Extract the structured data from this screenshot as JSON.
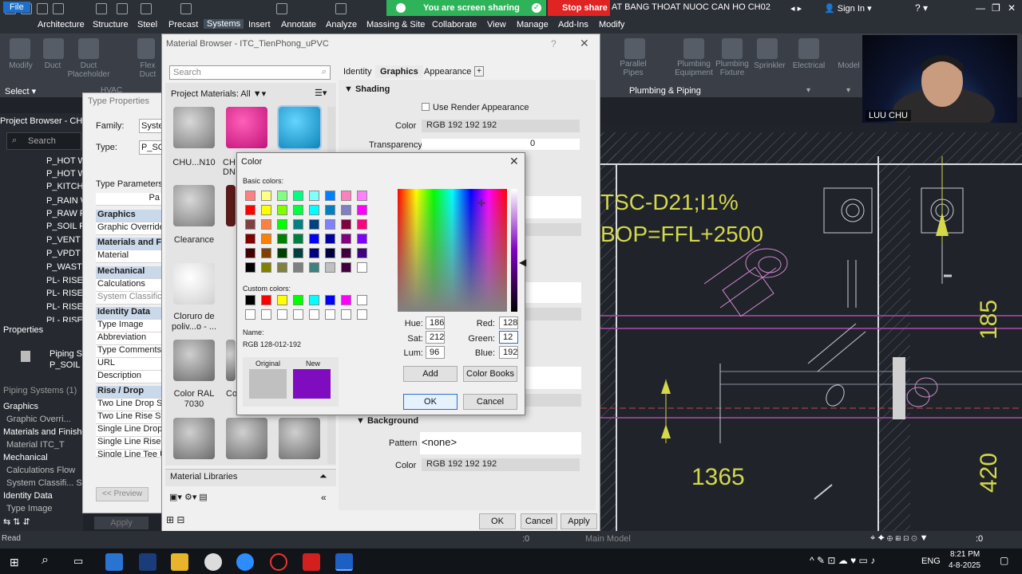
{
  "titlebar": {
    "share_text": "You are screen sharing",
    "stop_share": "Stop share",
    "doc_title": "AT BANG THOAT NUOC CAN HO CH02",
    "sign_in": "Sign In"
  },
  "menu": [
    "File",
    "Architecture",
    "Structure",
    "Steel",
    "Precast",
    "Systems",
    "Insert",
    "Annotate",
    "Analyze",
    "Massing & Site",
    "Collaborate",
    "View",
    "Manage",
    "Add-Ins",
    "Modify"
  ],
  "ribbon": {
    "tools": [
      "Modify",
      "Duct",
      "Duct Placeholder",
      "Flex Duct",
      "Parallel Pipes",
      "Plumbing Equipment",
      "Plumbing Fixture",
      "Sprinkler",
      "Electrical",
      "Model"
    ],
    "select_label": "Select",
    "hvac_label": "HVAC",
    "plumbing_panel": "Plumbing & Piping"
  },
  "project_browser": {
    "title": "Project Browser - CHU",
    "search_placeholder": "Search",
    "items": [
      "P_HOT WA",
      "P_HOT WA",
      "P_KITCHEN",
      "P_RAIN W",
      "P_RAW PI",
      "P_SOIL PI",
      "P_VENT PI",
      "P_VPDT",
      "P_WASTE",
      "PL- RISER",
      "PL- RISER",
      "PL- RISER",
      "PL- RISER"
    ]
  },
  "properties": {
    "title": "Properties",
    "type_name": "Piping Sy",
    "type_sub": "P_SOIL PI",
    "filter": "Piping Systems (1)",
    "rows": [
      "Graphics",
      "Graphic Overri...",
      "Materials and Finishes",
      "Material  ITC_T",
      "Mechanical",
      "Calculations  Flow",
      "System Classifi...  Sanit",
      "Identity Data",
      "Type Image"
    ],
    "apply": "Apply"
  },
  "type_properties": {
    "title": "Type Properties",
    "family_label": "Family:",
    "family_value": "System",
    "type_label": "Type:",
    "type_value": "P_SOI",
    "params_label": "Type Parameters",
    "param_header": "Pa",
    "rows": [
      "Graphics",
      "Graphic Overrides",
      "Materials and Fin",
      "Material",
      "Mechanical",
      "Calculations",
      "System Classificat",
      "Identity Data",
      "Type Image",
      "Abbreviation",
      "Type Comments",
      "URL",
      "Description",
      "Rise / Drop",
      "Two Line Drop Sy",
      "Two Line Rise Sym",
      "Single Line Drop S",
      "Single Line Rise Sy",
      "Single Line Tee Up"
    ],
    "preview_btn": "<< Preview"
  },
  "material_browser": {
    "title": "Material Browser - ITC_TienPhong_uPVC",
    "search_placeholder": "Search",
    "project_materials": "Project Materials: All",
    "materials": [
      {
        "label": "CHU...N10",
        "color": "#9a9a9a"
      },
      {
        "label": "CH DN",
        "color": "#e0198c"
      },
      {
        "label": "",
        "color": "#1ea6d8"
      },
      {
        "label": "Clearance",
        "color": "#9a9a9a"
      },
      {
        "label": "",
        "color": "#5a1a1a"
      },
      {
        "label": "Cloruro de poliv...o - ...",
        "color": "#e8e8e8"
      },
      {
        "label": "Color RAL 7030",
        "color": "#8f8f8f"
      },
      {
        "label": "Co",
        "color": "#909090"
      },
      {
        "label": "",
        "color": "#8e8e8e"
      },
      {
        "label": "",
        "color": "#8e8e8e"
      },
      {
        "label": "",
        "color": "#8e8e8e"
      }
    ],
    "libraries": "Material Libraries",
    "tabs": [
      "Identity",
      "Graphics",
      "Appearance"
    ],
    "active_tab": "Graphics",
    "shading": "Shading",
    "use_render": "Use Render Appearance",
    "color_label": "Color",
    "color_value": "RGB 192 192 192",
    "transparency_label": "Transparency",
    "transparency_value": "0",
    "background": "Background",
    "pattern_label": "Pattern",
    "pattern_value": "<none>",
    "bg_color_label": "Color",
    "bg_color_value": "RGB 192 192 192",
    "ok": "OK",
    "cancel": "Cancel",
    "apply": "Apply"
  },
  "color_dialog": {
    "title": "Color",
    "basic_colors_label": "Basic colors:",
    "custom_colors_label": "Custom colors:",
    "name_label": "Name:",
    "name_value": "RGB 128-012-192",
    "original_label": "Original",
    "new_label": "New",
    "original_color": "#c0c0c0",
    "new_color": "#800cc0",
    "hue_label": "Hue:",
    "hue": "186",
    "sat_label": "Sat:",
    "sat": "212",
    "lum_label": "Lum:",
    "lum": "96",
    "red_label": "Red:",
    "red": "128",
    "green_label": "Green:",
    "green": "12",
    "blue_label": "Blue:",
    "blue": "192",
    "add_btn": "Add",
    "color_books_btn": "Color Books",
    "ok": "OK",
    "cancel": "Cancel",
    "basic_colors": [
      "#ff8080",
      "#ffff80",
      "#80ff80",
      "#00ff80",
      "#80ffff",
      "#0080ff",
      "#ff80c0",
      "#ff80ff",
      "#ff0000",
      "#ffff00",
      "#80ff00",
      "#00ff40",
      "#00ffff",
      "#0080c0",
      "#8080c0",
      "#ff00ff",
      "#804040",
      "#ff8040",
      "#00ff00",
      "#008080",
      "#004080",
      "#8080ff",
      "#800040",
      "#ff0080",
      "#800000",
      "#ff8000",
      "#008000",
      "#008040",
      "#0000ff",
      "#0000a0",
      "#800080",
      "#8000ff",
      "#400000",
      "#804000",
      "#004000",
      "#004040",
      "#000080",
      "#000040",
      "#400040",
      "#400080",
      "#000000",
      "#808000",
      "#808040",
      "#808080",
      "#408080",
      "#c0c0c0",
      "#400040",
      "#ffffff"
    ],
    "custom_colors": [
      "#000000",
      "#ff0000",
      "#ffff00",
      "#00ff00",
      "#00ffff",
      "#0000ff",
      "#ff00ff",
      "#ffffff",
      "#ffffff",
      "#ffffff",
      "#ffffff",
      "#ffffff",
      "#ffffff",
      "#ffffff",
      "#ffffff",
      "#ffffff"
    ]
  },
  "cad": {
    "text1": "TSC-D21;I1%",
    "text2": "BOP=FFL+2500",
    "dim1": "1365",
    "dim2": "185",
    "dim3": "420"
  },
  "webcam": {
    "name": "LUU CHU"
  },
  "statusbar": {
    "model": "Main Model",
    "zero1": ":0",
    "zero2": ":0"
  },
  "taskbar": {
    "lang": "ENG",
    "time": "8:21 PM",
    "date": "4-8-2025"
  }
}
